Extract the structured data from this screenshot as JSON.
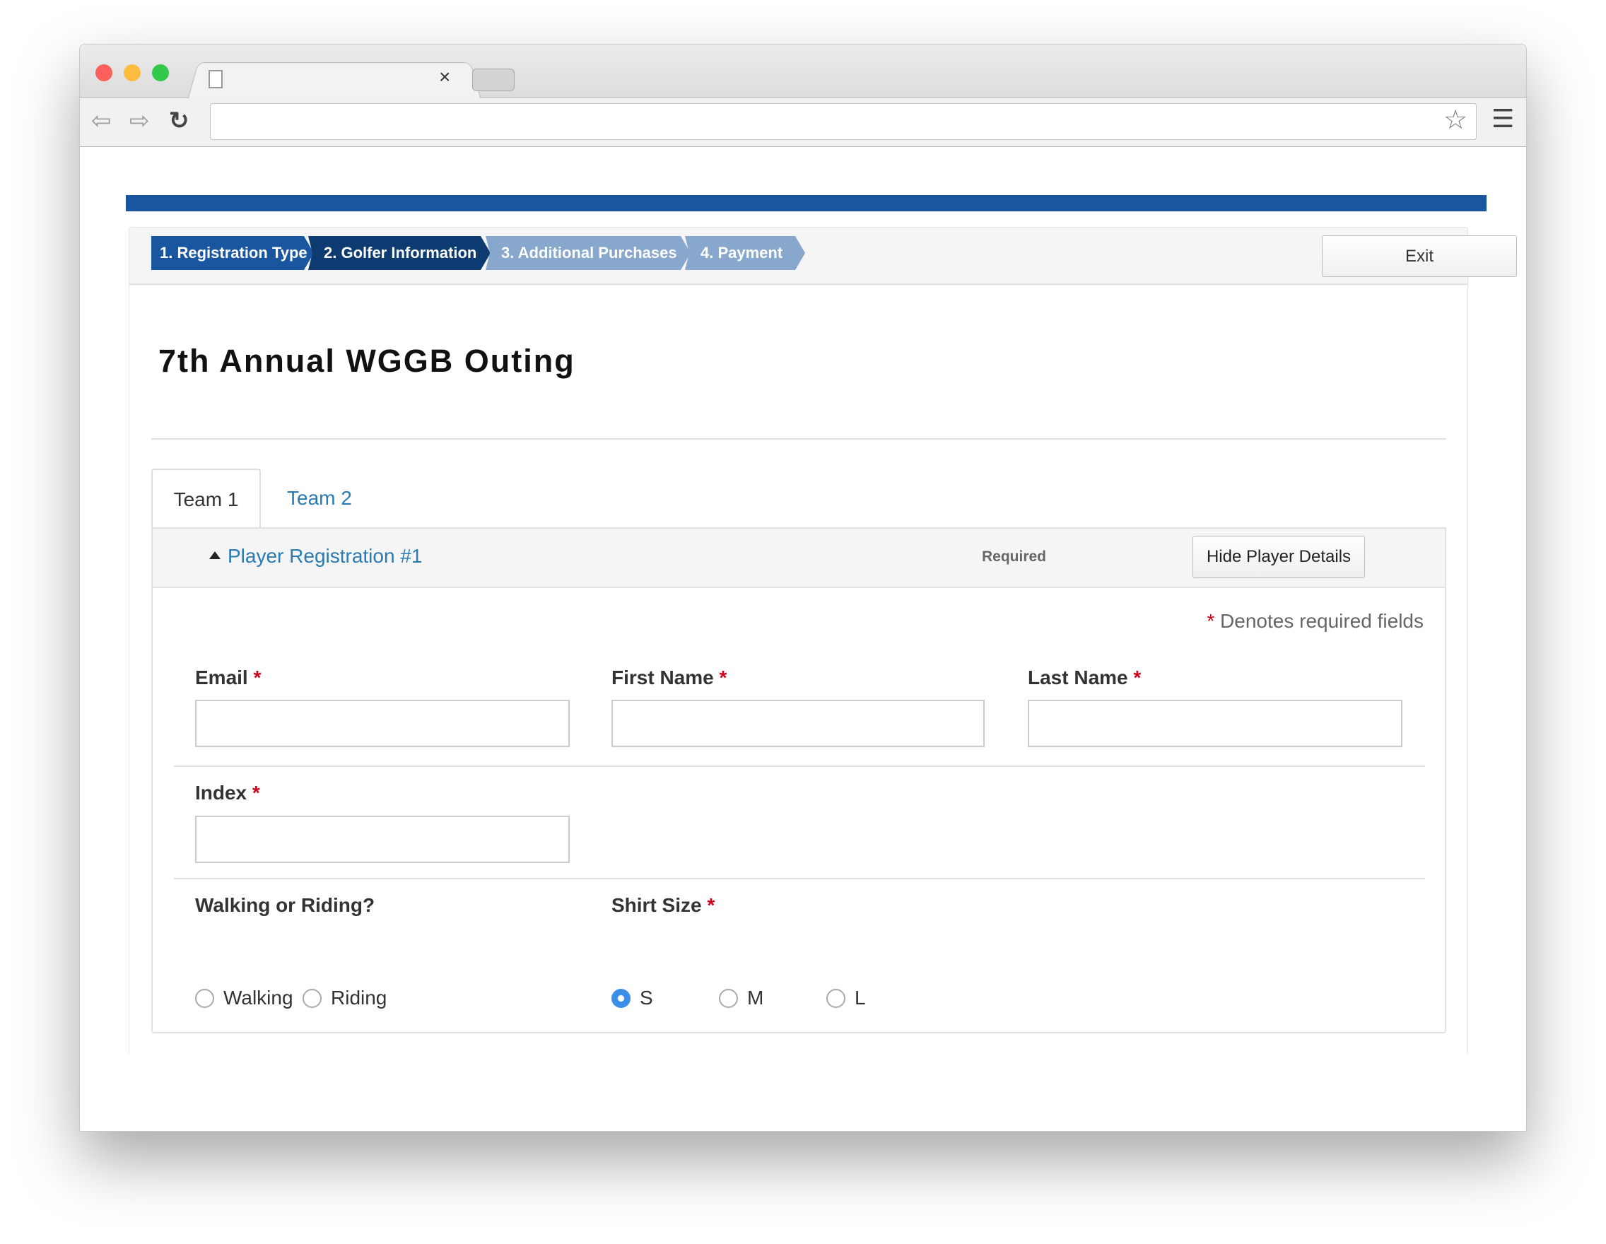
{
  "browser": {
    "tab_close": "×",
    "icons": [
      "back-arrow-icon",
      "forward-arrow-icon",
      "reload-icon",
      "star-icon",
      "menu-icon"
    ],
    "url": ""
  },
  "colors": {
    "brand": "#1a56a0",
    "active_step": "#0e3a72",
    "inactive_step": "#87a7cc",
    "required": "#d0021b",
    "link": "#2a7ab3"
  },
  "steps": [
    {
      "label": "1. Registration Type",
      "state": "complete"
    },
    {
      "label": "2. Golfer Information",
      "state": "current"
    },
    {
      "label": "3. Additional Purchases",
      "state": "upcoming"
    },
    {
      "label": "4. Payment",
      "state": "upcoming"
    }
  ],
  "exit_label": "Exit",
  "event_title": "7th Annual WGGB Outing",
  "tabs": [
    {
      "label": "Team 1",
      "active": true
    },
    {
      "label": "Team 2",
      "active": false
    }
  ],
  "player": {
    "title": "Player Registration #1",
    "status": "Required",
    "hide_button": "Hide Player Details"
  },
  "required_note": {
    "asterisk": "*",
    "text": "Denotes required fields"
  },
  "fields": {
    "email": {
      "label": "Email",
      "value": ""
    },
    "first_name": {
      "label": "First Name",
      "value": ""
    },
    "last_name": {
      "label": "Last Name",
      "value": ""
    },
    "index": {
      "label": "Index",
      "value": ""
    }
  },
  "walking": {
    "label": "Walking or Riding?",
    "options": [
      "Walking",
      "Riding"
    ],
    "selected": null
  },
  "shirt": {
    "label": "Shirt Size",
    "options": [
      "S",
      "M",
      "L"
    ],
    "selected": "S"
  }
}
